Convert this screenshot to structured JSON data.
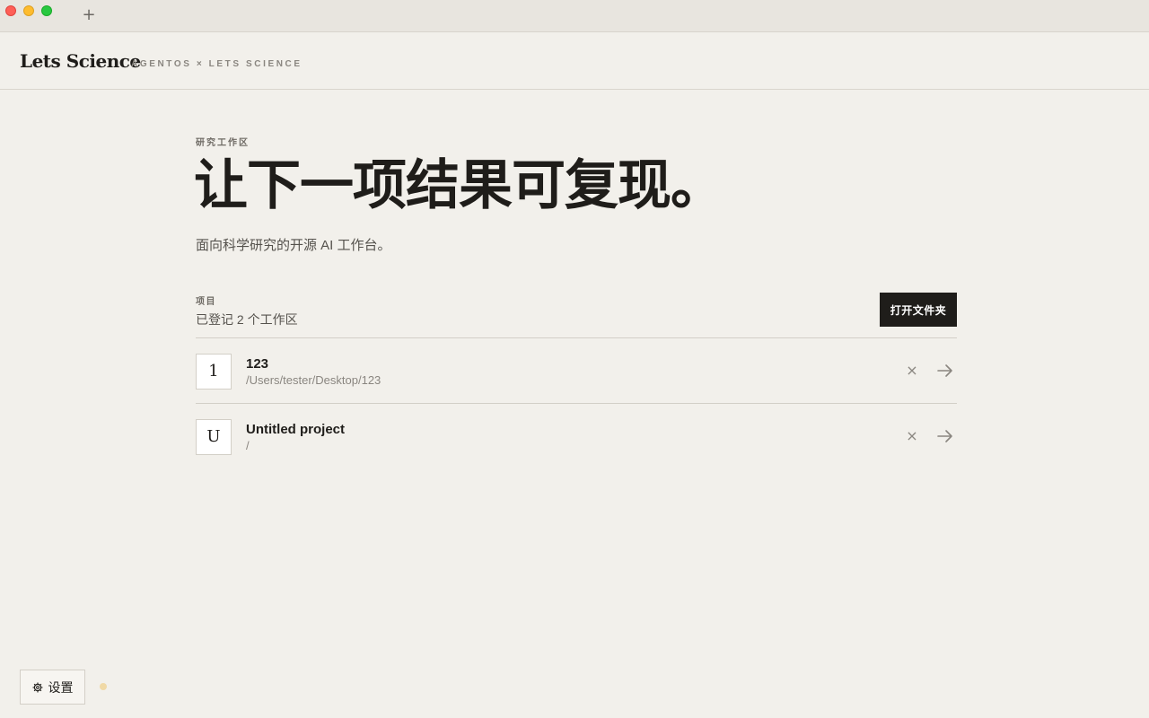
{
  "window": {
    "new_tab": "+"
  },
  "header": {
    "brand": "Lets Science",
    "subtitle": "AGENTOS × LETS SCIENCE"
  },
  "main": {
    "eyebrow": "研究工作区",
    "hero": "让下一项结果可复现。",
    "tagline": "面向科学研究的开源 AI 工作台。"
  },
  "projects": {
    "label": "项目",
    "count_text": "已登记 2 个工作区",
    "open_folder_label": "打开文件夹",
    "items": [
      {
        "initial": "1",
        "name": "123",
        "path": "/Users/tester/Desktop/123"
      },
      {
        "initial": "U",
        "name": "Untitled project",
        "path": "/"
      }
    ],
    "remove_glyph": "×",
    "open_icon": "arrow-right-icon"
  },
  "footer": {
    "settings_label": "设置",
    "settings_icon": "gear-icon",
    "status_color": "#f0d9a6"
  },
  "colors": {
    "background": "#f2f0eb",
    "accent_dark": "#1f1d1a"
  }
}
